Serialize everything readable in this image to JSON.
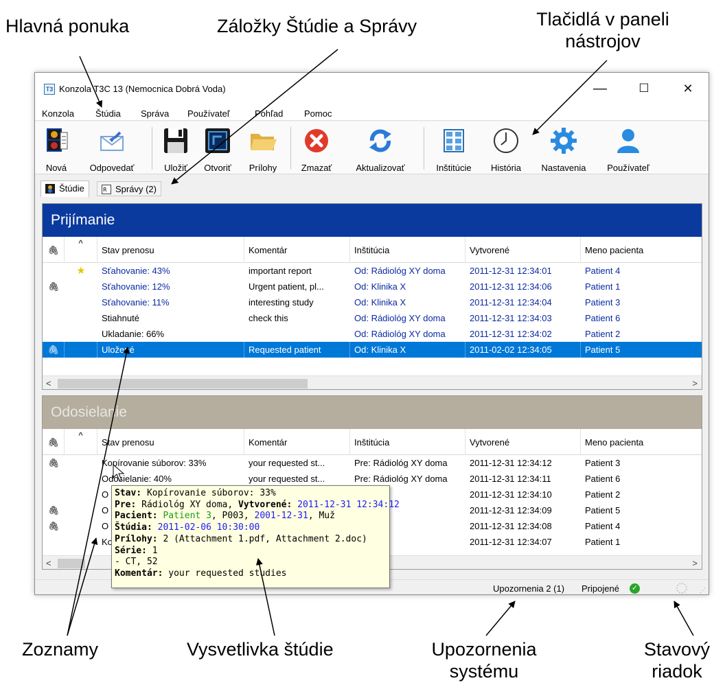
{
  "callouts": {
    "main_menu": "Hlavná ponuka",
    "tabs": "Záložky Štúdie a Správy",
    "toolbar_buttons_1": "Tlačidlá v paneli",
    "toolbar_buttons_2": "nástrojov",
    "lists": "Zoznamy",
    "study_tooltip": "Vysvetlivka štúdie",
    "system_alerts_1": "Upozornenia",
    "system_alerts_2": "systému",
    "status_bar_1": "Stavový",
    "status_bar_2": "riadok"
  },
  "window": {
    "title": "Konzola T3C 13 (Nemocnica Dobrá Voda)",
    "icon_text": "T3",
    "minimize": "—",
    "maximize": "☐",
    "close": "✕"
  },
  "menu": [
    "Konzola",
    "Štúdia",
    "Správa",
    "Používateľ",
    "Pohľad",
    "Pomoc"
  ],
  "toolbar": [
    {
      "label": "Nová",
      "icon": "new-study-icon"
    },
    {
      "label": "Odpovedať",
      "icon": "reply-envelope-icon"
    },
    {
      "label": "Uložiť",
      "icon": "save-floppy-icon"
    },
    {
      "label": "Otvoriť",
      "icon": "open-screen-icon"
    },
    {
      "label": "Prílohy",
      "icon": "attachments-folder-icon"
    },
    {
      "label": "Zmazať",
      "icon": "delete-icon"
    },
    {
      "label": "Aktualizovať",
      "icon": "refresh-icon"
    },
    {
      "label": "Inštitúcie",
      "icon": "institutions-grid-icon"
    },
    {
      "label": "História",
      "icon": "history-clock-icon"
    },
    {
      "label": "Nastavenia",
      "icon": "settings-gear-icon"
    },
    {
      "label": "Používateľ",
      "icon": "user-icon"
    }
  ],
  "tabs": [
    {
      "label": "Štúdie",
      "active": true
    },
    {
      "label": "Správy (2)",
      "active": false
    }
  ],
  "colors": {
    "receive_header": "#0a3a9e",
    "send_header": "#b5ae9e",
    "selection": "#0078d7",
    "tooltip_bg": "#ffffe1"
  },
  "receiving": {
    "title": "Prijímanie",
    "columns": [
      "Stav prenosu",
      "Komentár",
      "Inštitúcia",
      "Vytvorené",
      "Meno pacienta"
    ],
    "rows": [
      {
        "attach": "",
        "flag": "★",
        "status": "Sťahovanie: 43%",
        "comment": "important report",
        "institution": "Od: Rádiológ XY doma",
        "created": "2011-12-31 12:34:01",
        "patient": "Patient 4",
        "selected": false,
        "blue": true
      },
      {
        "attach": "🖇",
        "flag": "",
        "status": "Sťahovanie: 12%",
        "comment": "Urgent patient, pl...",
        "institution": "Od: Klinika X",
        "created": "2011-12-31 12:34:06",
        "patient": "Patient 1",
        "selected": false,
        "blue": true
      },
      {
        "attach": "",
        "flag": "",
        "status": "Sťahovanie: 11%",
        "comment": "interesting study",
        "institution": "Od: Klinika X",
        "created": "2011-12-31 12:34:04",
        "patient": "Patient 3",
        "selected": false,
        "blue": true
      },
      {
        "attach": "",
        "flag": "",
        "status": "Stiahnuté",
        "comment": "check this",
        "institution": "Od: Rádiológ XY doma",
        "created": "2011-12-31 12:34:03",
        "patient": "Patient 6",
        "selected": false,
        "blue": false
      },
      {
        "attach": "",
        "flag": "",
        "status": "Ukladanie: 66%",
        "comment": "",
        "institution": "Od: Rádiológ XY doma",
        "created": "2011-12-31 12:34:02",
        "patient": "Patient 2",
        "selected": false,
        "blue": false
      },
      {
        "attach": "🖇",
        "flag": "",
        "status": "Uložené",
        "comment": "Requested patient",
        "institution": "Od: Klinika X",
        "created": "2011-02-02 12:34:05",
        "patient": "Patient 5",
        "selected": true,
        "blue": false
      }
    ]
  },
  "sending": {
    "title": "Odosielanie",
    "columns": [
      "Stav prenosu",
      "Komentár",
      "Inštitúcia",
      "Vytvorené",
      "Meno pacienta"
    ],
    "rows": [
      {
        "attach": "🖇",
        "status": "Kopírovanie súborov: 33%",
        "comment": "your requested st...",
        "institution": "Pre: Rádiológ XY doma",
        "created": "2011-12-31 12:34:12",
        "patient": "Patient 3"
      },
      {
        "attach": "",
        "status": "Odosielanie: 40%",
        "comment": "your requested st...",
        "institution": "Pre: Rádiológ XY doma",
        "created": "2011-12-31 12:34:11",
        "patient": "Patient 6"
      },
      {
        "attach": "",
        "status": "O",
        "comment": "",
        "institution": "oma",
        "created": "2011-12-31 12:34:10",
        "patient": "Patient 2"
      },
      {
        "attach": "🖇",
        "status": "O",
        "comment": "",
        "institution": "",
        "created": "2011-12-31 12:34:09",
        "patient": "Patient 5"
      },
      {
        "attach": "🖇",
        "status": "O",
        "comment": "",
        "institution": "",
        "created": "2011-12-31 12:34:08",
        "patient": "Patient 4"
      },
      {
        "attach": "",
        "status": "Ko",
        "comment": "",
        "institution": "",
        "created": "2011-12-31 12:34:07",
        "patient": "Patient 1"
      }
    ]
  },
  "tooltip": {
    "stav_label": "Stav:",
    "stav_value": "Kopírovanie súborov: 33%",
    "pre_label": "Pre:",
    "pre_value": "Rádiológ XY doma,",
    "created_label": "Vytvorené:",
    "created_value": "2011-12-31 12:34:12",
    "patient_label": "Pacient:",
    "patient_name": "Patient 3",
    "patient_id": ", P003,",
    "patient_dob": "2001-12-31",
    "patient_sex": ", Muž",
    "studies_label": "Štúdia:",
    "studies_value": "2011-02-06 10:30:00",
    "attachments_label": "Prílohy:",
    "attachments_value": "2 (Attachment 1.pdf, Attachment 2.doc)",
    "series_label": "Série:",
    "series_value": "1",
    "series_line": "- CT, 52",
    "comment_label": "Komentár:",
    "comment_value": "your requested studies"
  },
  "statusbar": {
    "alerts": "Upozornenia 2 (1)",
    "connected": "Pripojené"
  }
}
